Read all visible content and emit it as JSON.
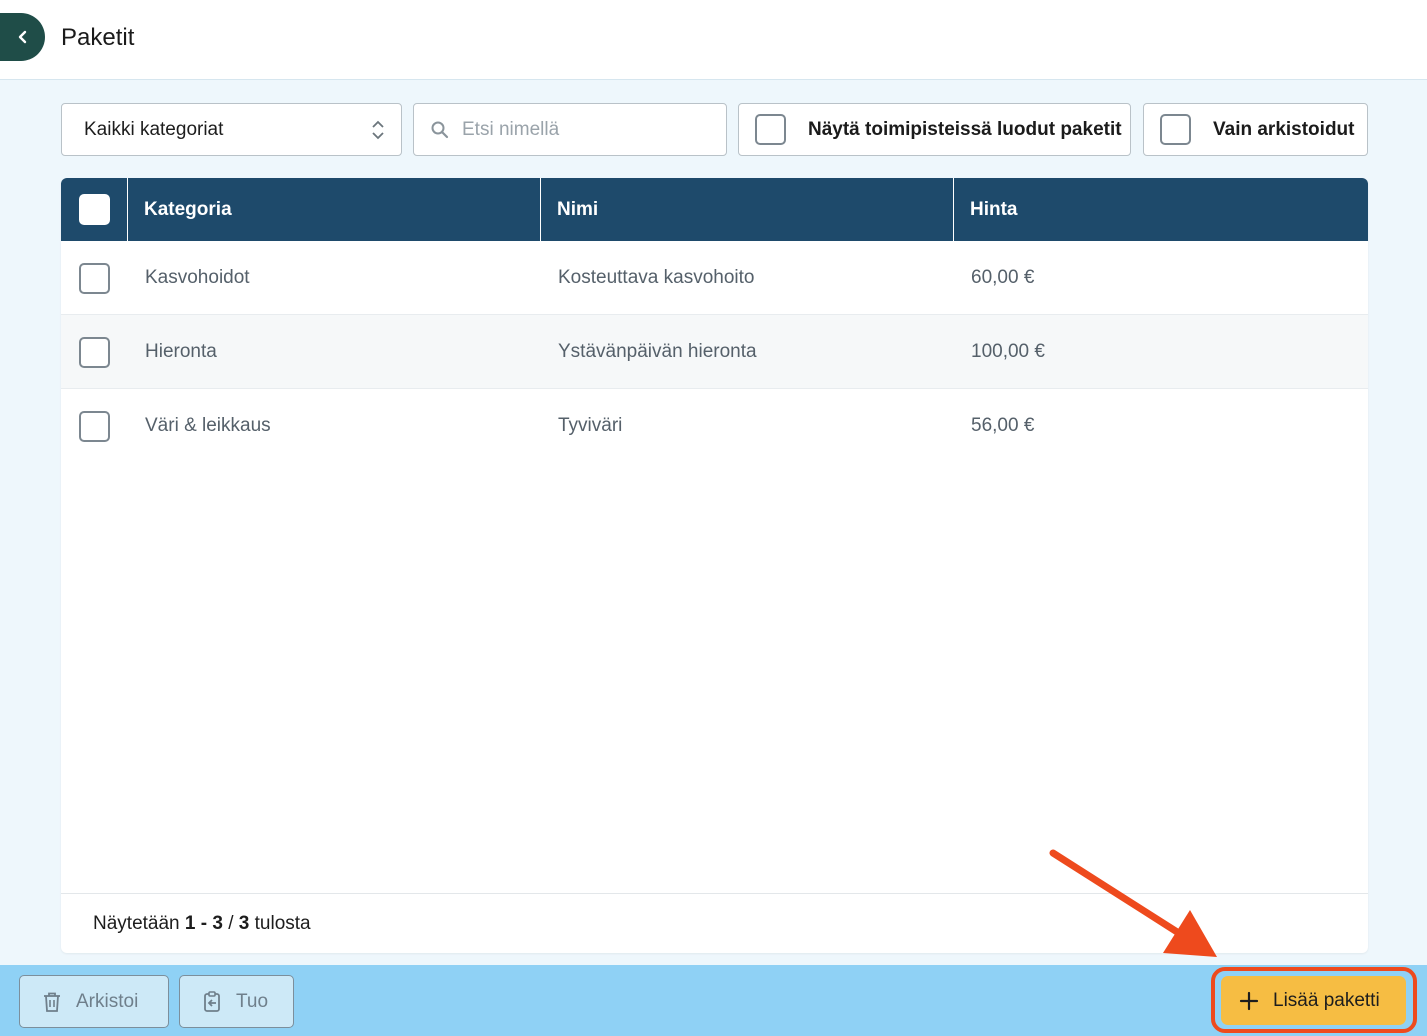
{
  "header": {
    "title": "Paketit",
    "back_icon": "chevron-left-icon"
  },
  "filters": {
    "category_select": {
      "selected": "Kaikki kategoriat"
    },
    "search": {
      "placeholder": "Etsi nimellä",
      "value": ""
    },
    "show_location_packages_label": "Näytä toimipisteissä luodut paketit",
    "only_archived_label": "Vain arkistoidut"
  },
  "table": {
    "columns": [
      "Kategoria",
      "Nimi",
      "Hinta"
    ],
    "rows": [
      {
        "category": "Kasvohoidot",
        "name": "Kosteuttava kasvohoito",
        "price": "60,00 €"
      },
      {
        "category": "Hieronta",
        "name": "Ystävänpäivän hieronta",
        "price": "100,00 €"
      },
      {
        "category": "Väri & leikkaus",
        "name": "Tyviväri",
        "price": "56,00 €"
      }
    ],
    "footer": {
      "prefix": "Näytetään ",
      "range": "1 - 3",
      "separator": " / ",
      "total": "3",
      "suffix": " tulosta"
    }
  },
  "bottom_bar": {
    "archive_label": "Arkistoi",
    "import_label": "Tuo",
    "add_label": "Lisää paketti"
  },
  "colors": {
    "header_dark": "#1e4a6b",
    "back_button": "#1f4d48",
    "bottom_bar": "#8fd1f5",
    "add_button": "#f6bd43",
    "highlight": "#ee4a1d"
  }
}
